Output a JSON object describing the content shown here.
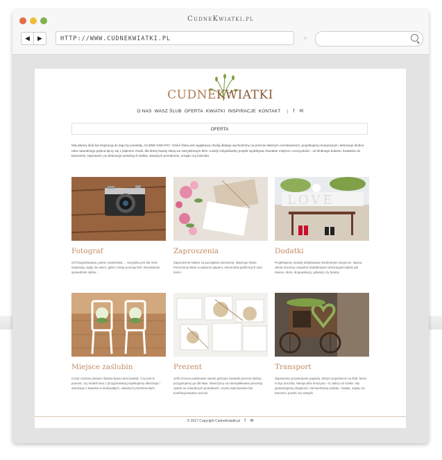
{
  "window": {
    "title": "CudneKwiatki.pl"
  },
  "browser": {
    "address": "HTTP://WWW.CUDNEKWIATKI.PL",
    "back_icon": "back-arrow-icon",
    "forward_icon": "forward-arrow-icon",
    "search_icon": "search-icon"
  },
  "site": {
    "logo": {
      "part1": "CUDNE",
      "part2": "KWIATKI"
    },
    "menu": [
      "O NAS",
      "WASZ ŚLUB",
      "OFERTA",
      "KWIATKI",
      "INSPIRACJE",
      "KONTAKT"
    ],
    "social": {
      "facebook": "f",
      "mail": "✉"
    },
    "tab_label": "OFERTA",
    "intro": "Mój własny ślub był inspiracją do tego by powstały „CUDNE KWIATKI\". Dzień ślubu jest wyjątkową chwilą dlatego wychodzimy na przeciw Waszym oczekiwaniom, projektujemy kompozycje i dekoracje ślubne. Idea naturalnego piękna łączy się z pięknem chwili, dla której kwiaty służą we wszystkowym tłem. Każdy indywidualny projekt wydobywa charakter miejsca i uroczystości - od ślubnego bukietu, kwiatków do butonierki, zaproszeń, po dekoracje weselnych stołów, otwartych przestrzeni, urządu czy kościoła.",
    "cards": [
      {
        "title": "Fotograf",
        "desc": "Od fotografowania, potem szaleństwa … wszystko jest dla mnie inspiracją, nigdy nie wiem, gdzie i kiedy poczuję kiść. Nieustannie sprawdzam siebie…"
      },
      {
        "title": "Zaproszenia",
        "desc": "Zaproszenie ślubne za początkiem pierwszej. Waszego ślubu. Pomożemy Wam w wyborze papieru, elementów graficznych oraz treści."
      },
      {
        "title": "Dodatki",
        "desc": "Projektujemy ozdoby dedykowane konkretnym miejscom. Nasza oferta mocemy uzupełnić dodatkowymi dekoracjami takimi jak świece, dielo, drogowskazy, girlandy czy balony."
      },
      {
        "title": "Miejsce zaślubin",
        "desc": "Coraz częściej miejsce ślubów bywa nieoczywiste. Czy jest to pomost, czy środek lasu z przygotowaną projektujemy dekoracje i aranżacje z kwiatów w niebywałych, otwartych przestrzeniach."
      },
      {
        "title": "Prezent",
        "desc": "Jeśli chcecie podarować swoim gościom niewielki prezent ślubny, przygotujemy go dla Was. Stworzymy na niezwykłewane prezenty, oparte na naturalnych produktach, często wykonywane lub konfekcjonowane ręcznie."
      },
      {
        "title": "Transport",
        "desc": "Zapewnimy przystrojenie pojazdu, którym pojedziecie na ślub. Może to być dorożka, Wespa albo limuzyna - to zależy od Ciebie. My gwarantujemy elegancki i niemachanną ozdobę - kwiaty, napisy na karoserii, puszki czy wstążki."
      }
    ],
    "footer": "© 2017 Copyright CudneKwiatki.pl"
  },
  "colors": {
    "accent": "#c28a63",
    "logo": "#b07a52",
    "leaf": "#7fa046"
  }
}
